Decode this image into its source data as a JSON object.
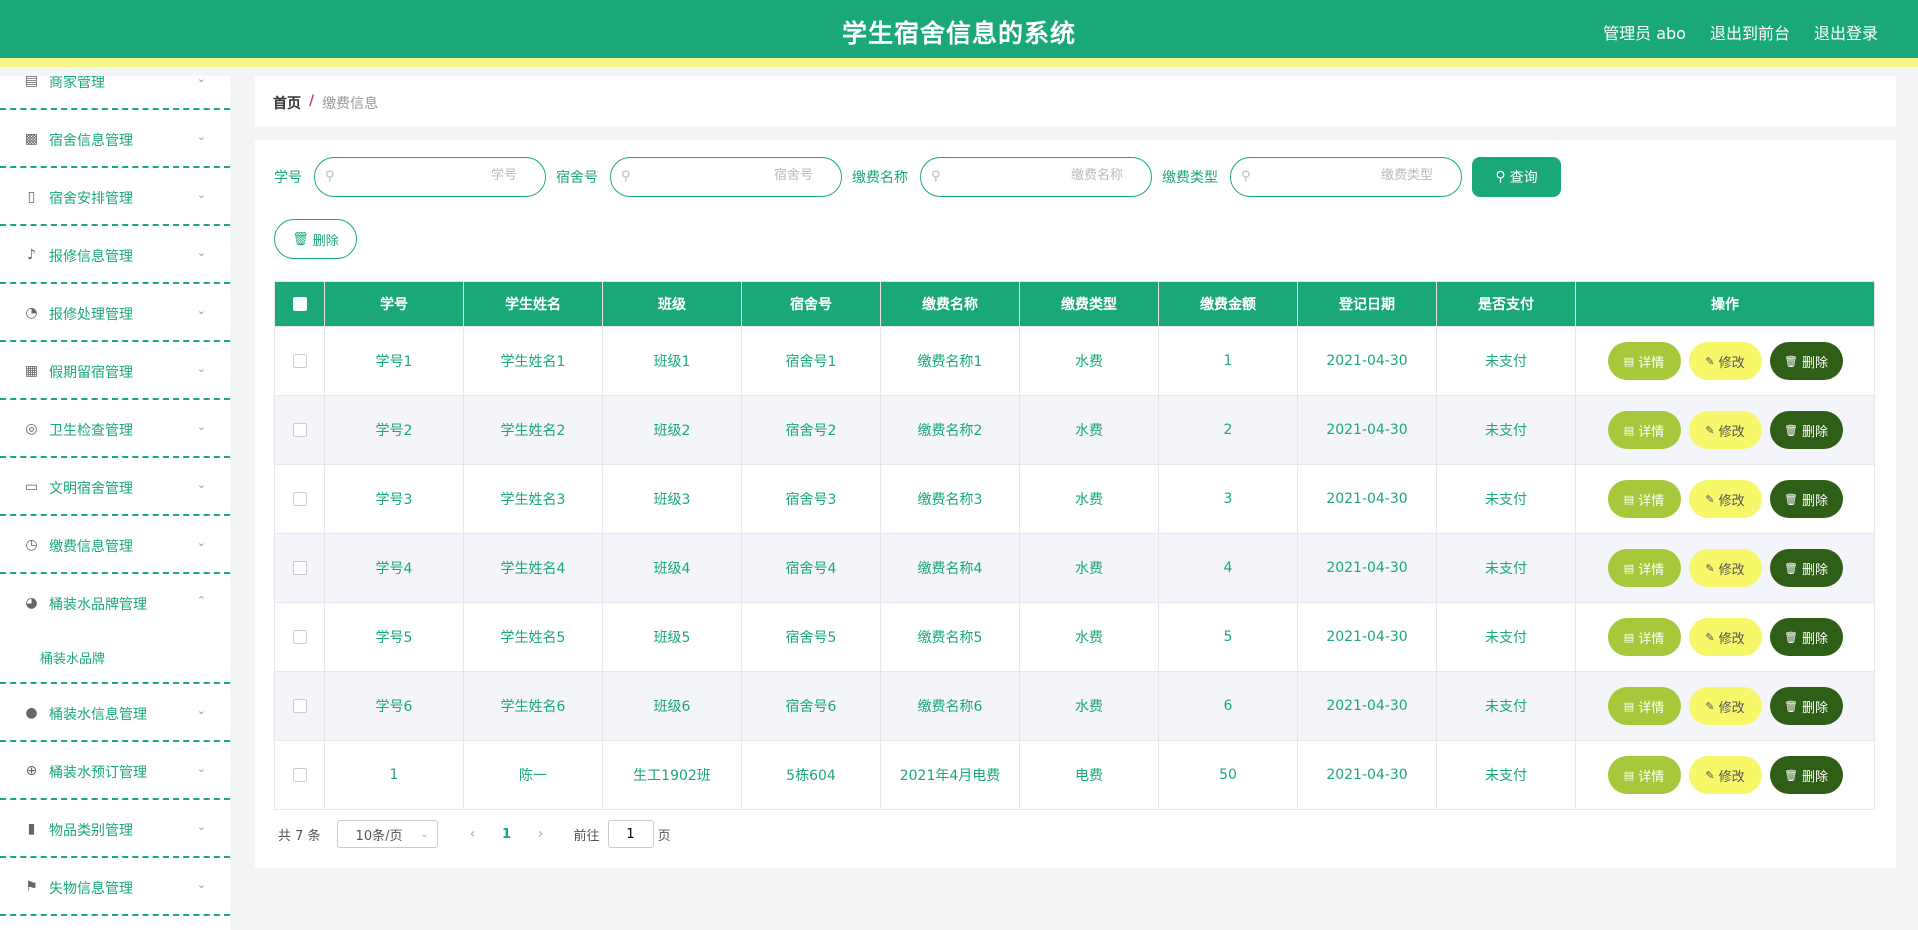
{
  "header": {
    "title": "学生宿舍信息的系统",
    "admin": "管理员 abo",
    "front": "退出到前台",
    "logout": "退出登录"
  },
  "sidebar": {
    "items": [
      {
        "label": "商家管理",
        "icon": "id-card-icon",
        "expanded": false
      },
      {
        "label": "宿舍信息管理",
        "icon": "briefcase-icon",
        "expanded": false
      },
      {
        "label": "宿舍安排管理",
        "icon": "clipboard-icon",
        "expanded": false
      },
      {
        "label": "报修信息管理",
        "icon": "bell-off-icon",
        "expanded": false
      },
      {
        "label": "报修处理管理",
        "icon": "gauge-icon",
        "expanded": false
      },
      {
        "label": "假期留宿管理",
        "icon": "grid-icon",
        "expanded": false
      },
      {
        "label": "卫生检查管理",
        "icon": "target-icon",
        "expanded": false
      },
      {
        "label": "文明宿舍管理",
        "icon": "chat-icon",
        "expanded": false
      },
      {
        "label": "缴费信息管理",
        "icon": "clock-icon",
        "expanded": false
      },
      {
        "label": "桶装水品牌管理",
        "icon": "compass-icon",
        "expanded": true
      },
      {
        "label": "桶装水信息管理",
        "icon": "user-icon",
        "expanded": false
      },
      {
        "label": "桶装水预订管理",
        "icon": "crosshair-icon",
        "expanded": false
      },
      {
        "label": "物品类别管理",
        "icon": "ticket-icon",
        "expanded": false
      },
      {
        "label": "失物信息管理",
        "icon": "flag-icon",
        "expanded": false
      }
    ],
    "submenu": "桶装水品牌"
  },
  "breadcrumb": {
    "home": "首页",
    "sep": "/",
    "current": "缴费信息"
  },
  "search": {
    "fields": [
      {
        "label": "学号",
        "placeholder": "学号"
      },
      {
        "label": "宿舍号",
        "placeholder": "宿舍号"
      },
      {
        "label": "缴费名称",
        "placeholder": "缴费名称"
      },
      {
        "label": "缴费类型",
        "placeholder": "缴费类型"
      }
    ],
    "query_label": "查询"
  },
  "toolbar": {
    "delete_label": "删除"
  },
  "table": {
    "headers": [
      "学号",
      "学生姓名",
      "班级",
      "宿舍号",
      "缴费名称",
      "缴费类型",
      "缴费金额",
      "登记日期",
      "是否支付",
      "操作"
    ],
    "rows": [
      [
        "学号1",
        "学生姓名1",
        "班级1",
        "宿舍号1",
        "缴费名称1",
        "水费",
        "1",
        "2021-04-30",
        "未支付"
      ],
      [
        "学号2",
        "学生姓名2",
        "班级2",
        "宿舍号2",
        "缴费名称2",
        "水费",
        "2",
        "2021-04-30",
        "未支付"
      ],
      [
        "学号3",
        "学生姓名3",
        "班级3",
        "宿舍号3",
        "缴费名称3",
        "水费",
        "3",
        "2021-04-30",
        "未支付"
      ],
      [
        "学号4",
        "学生姓名4",
        "班级4",
        "宿舍号4",
        "缴费名称4",
        "水费",
        "4",
        "2021-04-30",
        "未支付"
      ],
      [
        "学号5",
        "学生姓名5",
        "班级5",
        "宿舍号5",
        "缴费名称5",
        "水费",
        "5",
        "2021-04-30",
        "未支付"
      ],
      [
        "学号6",
        "学生姓名6",
        "班级6",
        "宿舍号6",
        "缴费名称6",
        "水费",
        "6",
        "2021-04-30",
        "未支付"
      ],
      [
        "1",
        "陈一",
        "生工1902班",
        "5栋604",
        "2021年4月电费",
        "电费",
        "50",
        "2021-04-30",
        "未支付"
      ]
    ],
    "actions": {
      "detail": "详情",
      "edit": "修改",
      "remove": "删除"
    }
  },
  "pagination": {
    "total": "共 7 条",
    "page_size": "10条/页",
    "current_page": "1",
    "goto_label": "前往",
    "goto_value": "1",
    "suffix": "页"
  },
  "colors": {
    "primary": "#1aa87a",
    "accent_yellow": "#f7f785",
    "detail": "#a6c83a",
    "edit": "#f7f76a",
    "remove": "#2f5e16"
  }
}
